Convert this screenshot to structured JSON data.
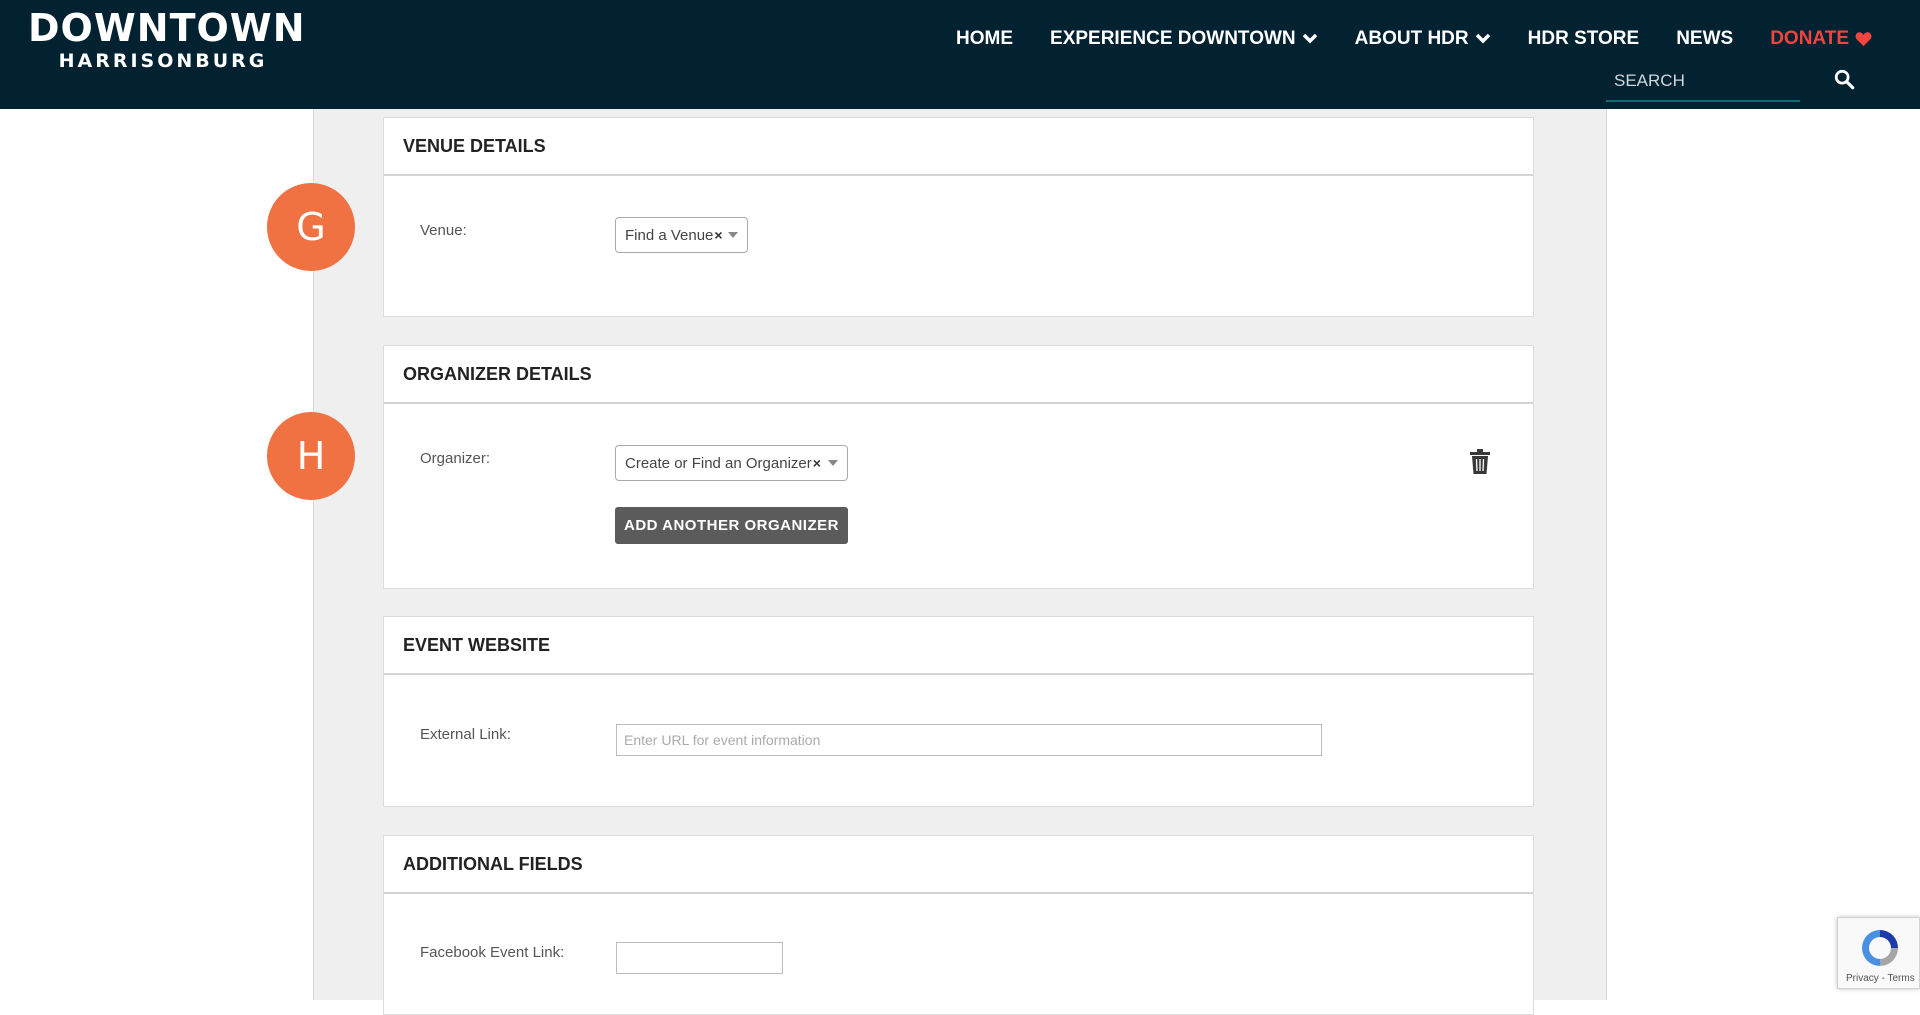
{
  "logo": {
    "main": "DOWNTOWN",
    "sub": "HARRISONBURG"
  },
  "nav": {
    "items": [
      {
        "label": "HOME",
        "dropdown": false
      },
      {
        "label": "EXPERIENCE DOWNTOWN",
        "dropdown": true
      },
      {
        "label": "ABOUT HDR",
        "dropdown": true
      },
      {
        "label": "HDR STORE",
        "dropdown": false
      },
      {
        "label": "NEWS",
        "dropdown": false
      },
      {
        "label": "DONATE",
        "dropdown": false,
        "icon": "heart-icon"
      }
    ],
    "search_placeholder": "SEARCH"
  },
  "sections": {
    "venue": {
      "title": "VENUE DETAILS",
      "field_label": "Venue:",
      "select_value": "Find a Venue",
      "clear_mark": "×"
    },
    "organizer": {
      "title": "ORGANIZER DETAILS",
      "field_label": "Organizer:",
      "select_value": "Create or Find an Organizer",
      "clear_mark": "×",
      "add_button": "ADD ANOTHER ORGANIZER",
      "delete_icon": "trash-icon"
    },
    "website": {
      "title": "EVENT WEBSITE",
      "field_label": "External Link:",
      "input_value": "",
      "input_placeholder": "Enter URL for event information"
    },
    "additional": {
      "title": "ADDITIONAL FIELDS",
      "field_label": "Facebook Event Link:",
      "input_value": ""
    }
  },
  "step_badges": {
    "g": "G",
    "h": "H"
  },
  "recaptcha": {
    "terms": "Privacy - Terms"
  },
  "colors": {
    "header_bg": "#022231",
    "donate": "#f0453f",
    "badge": "#f07142",
    "button_bg": "#5b5b5b",
    "page_bg": "#efefef"
  }
}
